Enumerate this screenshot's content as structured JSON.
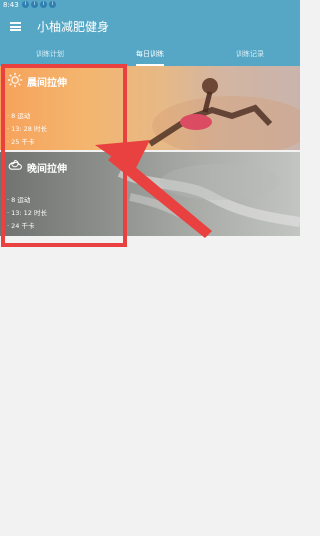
{
  "status_bar": {
    "time": "8:43",
    "notification_icons": [
      "notification-icon",
      "notification-icon",
      "notification-icon",
      "notification-icon"
    ]
  },
  "app_bar": {
    "title": "小柚减肥健身",
    "menu_icon": "menu-icon"
  },
  "tabs": [
    {
      "label": "训练计划",
      "active": false
    },
    {
      "label": "每日训练",
      "active": true
    },
    {
      "label": "训练记录",
      "active": false
    }
  ],
  "workouts": [
    {
      "title": "晨间拉伸",
      "icon": "sun-icon",
      "stats": [
        "· 8 运动",
        "· 13: 28 时长",
        "· 25 千卡"
      ]
    },
    {
      "title": "晚间拉伸",
      "icon": "moon-cloud-icon",
      "stats": [
        "· 8 运动",
        "· 13: 12 时长",
        "· 24 千卡"
      ]
    }
  ],
  "colors": {
    "primary": "#56a7c5",
    "annotation_red": "#e8413f",
    "background": "#f2f2f2"
  }
}
